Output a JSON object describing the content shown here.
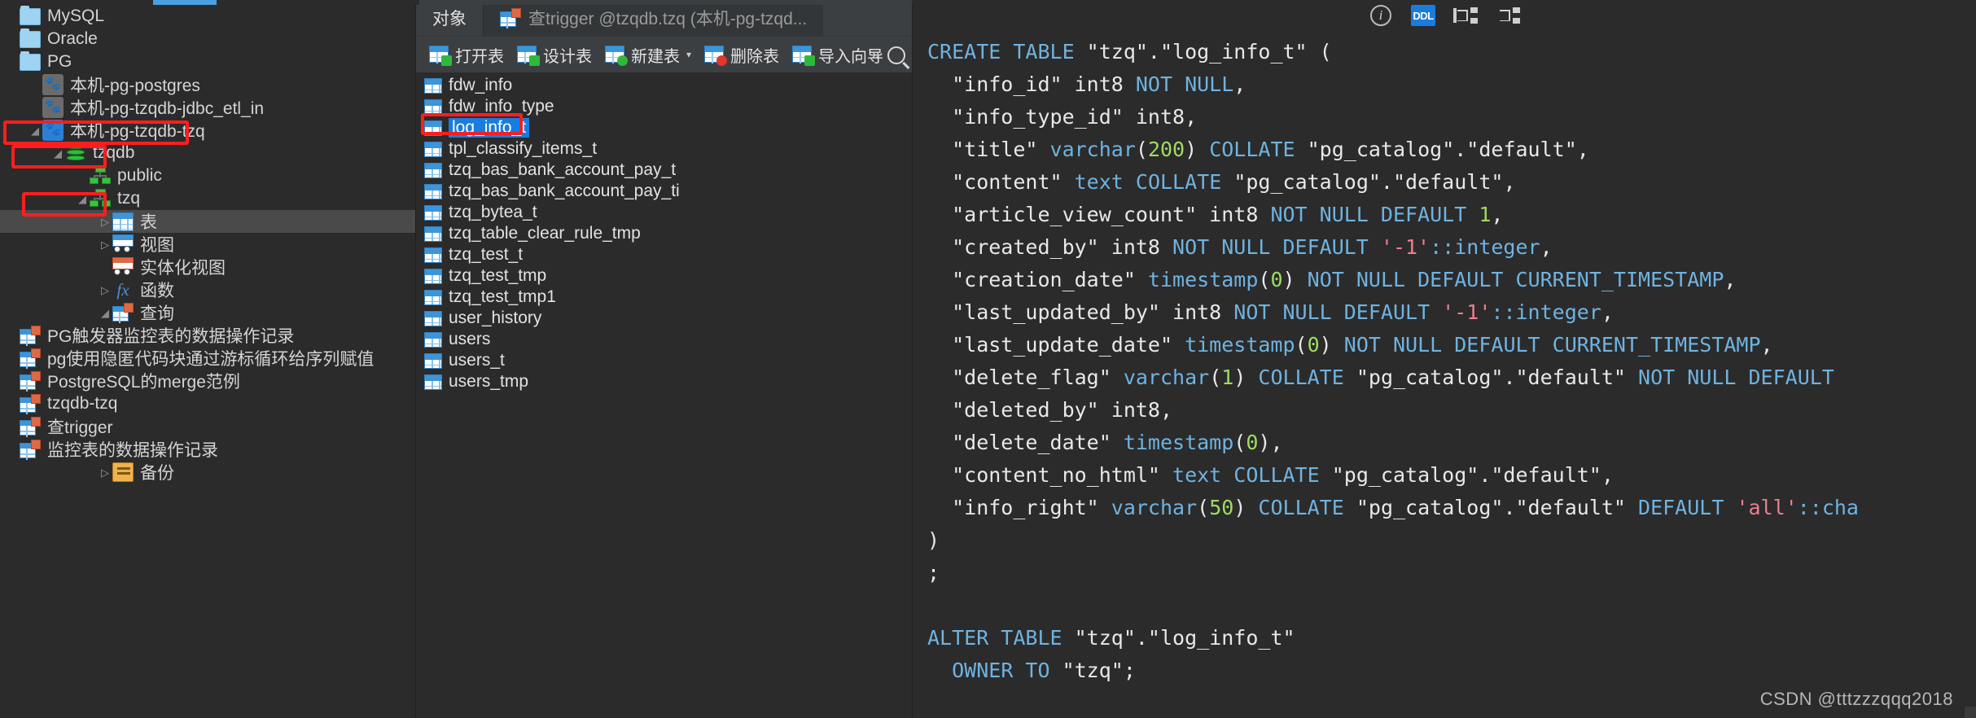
{
  "sidebar": {
    "items": [
      {
        "label": "MySQL",
        "icon": "folder-icon",
        "indent": 1,
        "twisty": "none",
        "selected": false
      },
      {
        "label": "Oracle",
        "icon": "folder-icon",
        "indent": 1,
        "twisty": "none",
        "selected": false
      },
      {
        "label": "PG",
        "icon": "folder-icon",
        "indent": 1,
        "twisty": "none",
        "selected": false
      },
      {
        "label": "本机-pg-postgres",
        "icon": "postgres-icon",
        "indent": 2,
        "twisty": "none",
        "selected": false
      },
      {
        "label": "本机-pg-tzqdb-jdbc_etl_in",
        "icon": "postgres-icon",
        "indent": 2,
        "twisty": "none",
        "selected": false
      },
      {
        "label": "本机-pg-tzqdb-tzq",
        "icon": "postgres-icon-active",
        "indent": 2,
        "twisty": "open",
        "selected": false
      },
      {
        "label": "tzqdb",
        "icon": "database-icon",
        "indent": 3,
        "twisty": "open",
        "selected": false
      },
      {
        "label": "public",
        "icon": "schema-icon",
        "indent": 4,
        "twisty": "none",
        "selected": false
      },
      {
        "label": "tzq",
        "icon": "schema-icon",
        "indent": 4,
        "twisty": "open",
        "selected": false
      },
      {
        "label": "表",
        "icon": "table-icon",
        "indent": 5,
        "twisty": "closed",
        "selected": true
      },
      {
        "label": "视图",
        "icon": "view-icon",
        "indent": 5,
        "twisty": "closed",
        "selected": false
      },
      {
        "label": "实体化视图",
        "icon": "matview-icon",
        "indent": 5,
        "twisty": "none",
        "selected": false
      },
      {
        "label": "函数",
        "icon": "function-icon",
        "indent": 5,
        "twisty": "closed",
        "selected": false
      },
      {
        "label": "查询",
        "icon": "query-icon",
        "indent": 5,
        "twisty": "open",
        "selected": false
      },
      {
        "label": "PG触发器监控表的数据操作记录",
        "icon": "query-item-icon",
        "indent": 6,
        "twisty": "none",
        "selected": false
      },
      {
        "label": "pg使用隐匿代码块通过游标循环给序列赋值",
        "icon": "query-item-icon",
        "indent": 6,
        "twisty": "none",
        "selected": false
      },
      {
        "label": "PostgreSQL的merge范例",
        "icon": "query-item-icon",
        "indent": 6,
        "twisty": "none",
        "selected": false
      },
      {
        "label": "tzqdb-tzq",
        "icon": "query-item-icon",
        "indent": 6,
        "twisty": "none",
        "selected": false
      },
      {
        "label": "查trigger",
        "icon": "query-item-icon",
        "indent": 6,
        "twisty": "none",
        "selected": false
      },
      {
        "label": "监控表的数据操作记录",
        "icon": "query-item-icon",
        "indent": 6,
        "twisty": "none",
        "selected": false
      },
      {
        "label": "备份",
        "icon": "backup-icon",
        "indent": 5,
        "twisty": "closed",
        "selected": false
      }
    ],
    "highlight_color": "#ff1e1e"
  },
  "middle": {
    "tabs": [
      {
        "label": "对象",
        "active": true,
        "icon": "none"
      },
      {
        "label": "查trigger @tzqdb.tzq (本机-pg-tzqd...",
        "active": false,
        "icon": "query-item-icon"
      }
    ],
    "toolbar": [
      {
        "label": "打开表",
        "icon": "open-table-icon",
        "caret": false
      },
      {
        "label": "设计表",
        "icon": "design-table-icon",
        "caret": false
      },
      {
        "label": "新建表",
        "icon": "new-table-icon",
        "caret": true
      },
      {
        "label": "删除表",
        "icon": "delete-table-icon",
        "caret": false
      },
      {
        "label": "导入向导",
        "icon": "import-wizard-icon",
        "caret": false
      }
    ],
    "toolbar_overflow_icon": "chevron-double-right-icon",
    "search_icon": "search-icon",
    "tables": [
      {
        "name": "fdw_info",
        "selected": false
      },
      {
        "name": "fdw_info_type",
        "selected": false
      },
      {
        "name": "log_info_t",
        "selected": true
      },
      {
        "name": "tpl_classify_items_t",
        "selected": false
      },
      {
        "name": "tzq_bas_bank_account_pay_t",
        "selected": false
      },
      {
        "name": "tzq_bas_bank_account_pay_ti",
        "selected": false
      },
      {
        "name": "tzq_bytea_t",
        "selected": false
      },
      {
        "name": "tzq_table_clear_rule_tmp",
        "selected": false
      },
      {
        "name": "tzq_test_t",
        "selected": false
      },
      {
        "name": "tzq_test_tmp",
        "selected": false
      },
      {
        "name": "tzq_test_tmp1",
        "selected": false
      },
      {
        "name": "user_history",
        "selected": false
      },
      {
        "name": "users",
        "selected": false
      },
      {
        "name": "users_t",
        "selected": false
      },
      {
        "name": "users_tmp",
        "selected": false
      }
    ]
  },
  "sql_panel": {
    "toolbar_icons": [
      {
        "name": "info-icon",
        "label": "i",
        "active": false
      },
      {
        "name": "ddl-icon",
        "label": "DDL",
        "active": true
      },
      {
        "name": "relations-out-icon",
        "label": "",
        "active": false
      },
      {
        "name": "relations-in-icon",
        "label": "",
        "active": false
      }
    ],
    "lines": [
      [
        {
          "t": "CREATE TABLE ",
          "c": "kw"
        },
        {
          "t": "\"tzq\".\"log_info_t\" (",
          "c": "plain"
        }
      ],
      [
        {
          "t": "  \"info_id\" int8 ",
          "c": "plain"
        },
        {
          "t": "NOT NULL",
          "c": "kw"
        },
        {
          "t": ",",
          "c": "plain"
        }
      ],
      [
        {
          "t": "  \"info_type_id\" int8,",
          "c": "plain"
        }
      ],
      [
        {
          "t": "  \"title\" ",
          "c": "plain"
        },
        {
          "t": "varchar",
          "c": "kw"
        },
        {
          "t": "(",
          "c": "plain"
        },
        {
          "t": "200",
          "c": "num"
        },
        {
          "t": ") ",
          "c": "plain"
        },
        {
          "t": "COLLATE ",
          "c": "kw"
        },
        {
          "t": "\"pg_catalog\".\"default\",",
          "c": "plain"
        }
      ],
      [
        {
          "t": "  \"content\" ",
          "c": "plain"
        },
        {
          "t": "text ",
          "c": "kw"
        },
        {
          "t": "COLLATE ",
          "c": "kw"
        },
        {
          "t": "\"pg_catalog\".\"default\",",
          "c": "plain"
        }
      ],
      [
        {
          "t": "  \"article_view_count\" int8 ",
          "c": "plain"
        },
        {
          "t": "NOT NULL DEFAULT ",
          "c": "kw"
        },
        {
          "t": "1",
          "c": "num"
        },
        {
          "t": ",",
          "c": "plain"
        }
      ],
      [
        {
          "t": "  \"created_by\" int8 ",
          "c": "plain"
        },
        {
          "t": "NOT NULL DEFAULT ",
          "c": "kw"
        },
        {
          "t": "'-1'",
          "c": "str"
        },
        {
          "t": "::integer",
          "c": "kw"
        },
        {
          "t": ",",
          "c": "plain"
        }
      ],
      [
        {
          "t": "  \"creation_date\" ",
          "c": "plain"
        },
        {
          "t": "timestamp",
          "c": "kw"
        },
        {
          "t": "(",
          "c": "plain"
        },
        {
          "t": "0",
          "c": "num"
        },
        {
          "t": ") ",
          "c": "plain"
        },
        {
          "t": "NOT NULL DEFAULT CURRENT_TIMESTAMP",
          "c": "kw"
        },
        {
          "t": ",",
          "c": "plain"
        }
      ],
      [
        {
          "t": "  \"last_updated_by\" int8 ",
          "c": "plain"
        },
        {
          "t": "NOT NULL DEFAULT ",
          "c": "kw"
        },
        {
          "t": "'-1'",
          "c": "str"
        },
        {
          "t": "::integer",
          "c": "kw"
        },
        {
          "t": ",",
          "c": "plain"
        }
      ],
      [
        {
          "t": "  \"last_update_date\" ",
          "c": "plain"
        },
        {
          "t": "timestamp",
          "c": "kw"
        },
        {
          "t": "(",
          "c": "plain"
        },
        {
          "t": "0",
          "c": "num"
        },
        {
          "t": ") ",
          "c": "plain"
        },
        {
          "t": "NOT NULL DEFAULT CURRENT_TIMESTAMP",
          "c": "kw"
        },
        {
          "t": ",",
          "c": "plain"
        }
      ],
      [
        {
          "t": "  \"delete_flag\" ",
          "c": "plain"
        },
        {
          "t": "varchar",
          "c": "kw"
        },
        {
          "t": "(",
          "c": "plain"
        },
        {
          "t": "1",
          "c": "num"
        },
        {
          "t": ") ",
          "c": "plain"
        },
        {
          "t": "COLLATE ",
          "c": "kw"
        },
        {
          "t": "\"pg_catalog\".\"default\" ",
          "c": "plain"
        },
        {
          "t": "NOT NULL DEFAULT",
          "c": "kw"
        }
      ],
      [
        {
          "t": "  \"deleted_by\" int8,",
          "c": "plain"
        }
      ],
      [
        {
          "t": "  \"delete_date\" ",
          "c": "plain"
        },
        {
          "t": "timestamp",
          "c": "kw"
        },
        {
          "t": "(",
          "c": "plain"
        },
        {
          "t": "0",
          "c": "num"
        },
        {
          "t": "),",
          "c": "plain"
        }
      ],
      [
        {
          "t": "  \"content_no_html\" ",
          "c": "plain"
        },
        {
          "t": "text ",
          "c": "kw"
        },
        {
          "t": "COLLATE ",
          "c": "kw"
        },
        {
          "t": "\"pg_catalog\".\"default\",",
          "c": "plain"
        }
      ],
      [
        {
          "t": "  \"info_right\" ",
          "c": "plain"
        },
        {
          "t": "varchar",
          "c": "kw"
        },
        {
          "t": "(",
          "c": "plain"
        },
        {
          "t": "50",
          "c": "num"
        },
        {
          "t": ") ",
          "c": "plain"
        },
        {
          "t": "COLLATE ",
          "c": "kw"
        },
        {
          "t": "\"pg_catalog\".\"default\" ",
          "c": "plain"
        },
        {
          "t": "DEFAULT ",
          "c": "kw"
        },
        {
          "t": "'all'",
          "c": "str"
        },
        {
          "t": "::cha",
          "c": "kw"
        }
      ],
      [
        {
          "t": ")",
          "c": "plain"
        }
      ],
      [
        {
          "t": ";",
          "c": "plain"
        }
      ],
      [
        {
          "t": "",
          "c": "plain"
        }
      ],
      [
        {
          "t": "ALTER TABLE ",
          "c": "kw"
        },
        {
          "t": "\"tzq\".\"log_info_t\"",
          "c": "plain"
        }
      ],
      [
        {
          "t": "  ",
          "c": "plain"
        },
        {
          "t": "OWNER TO ",
          "c": "kw"
        },
        {
          "t": "\"tzq\";",
          "c": "plain"
        }
      ]
    ]
  },
  "watermark": {
    "text": "CSDN @tttzzzqqq2018"
  }
}
